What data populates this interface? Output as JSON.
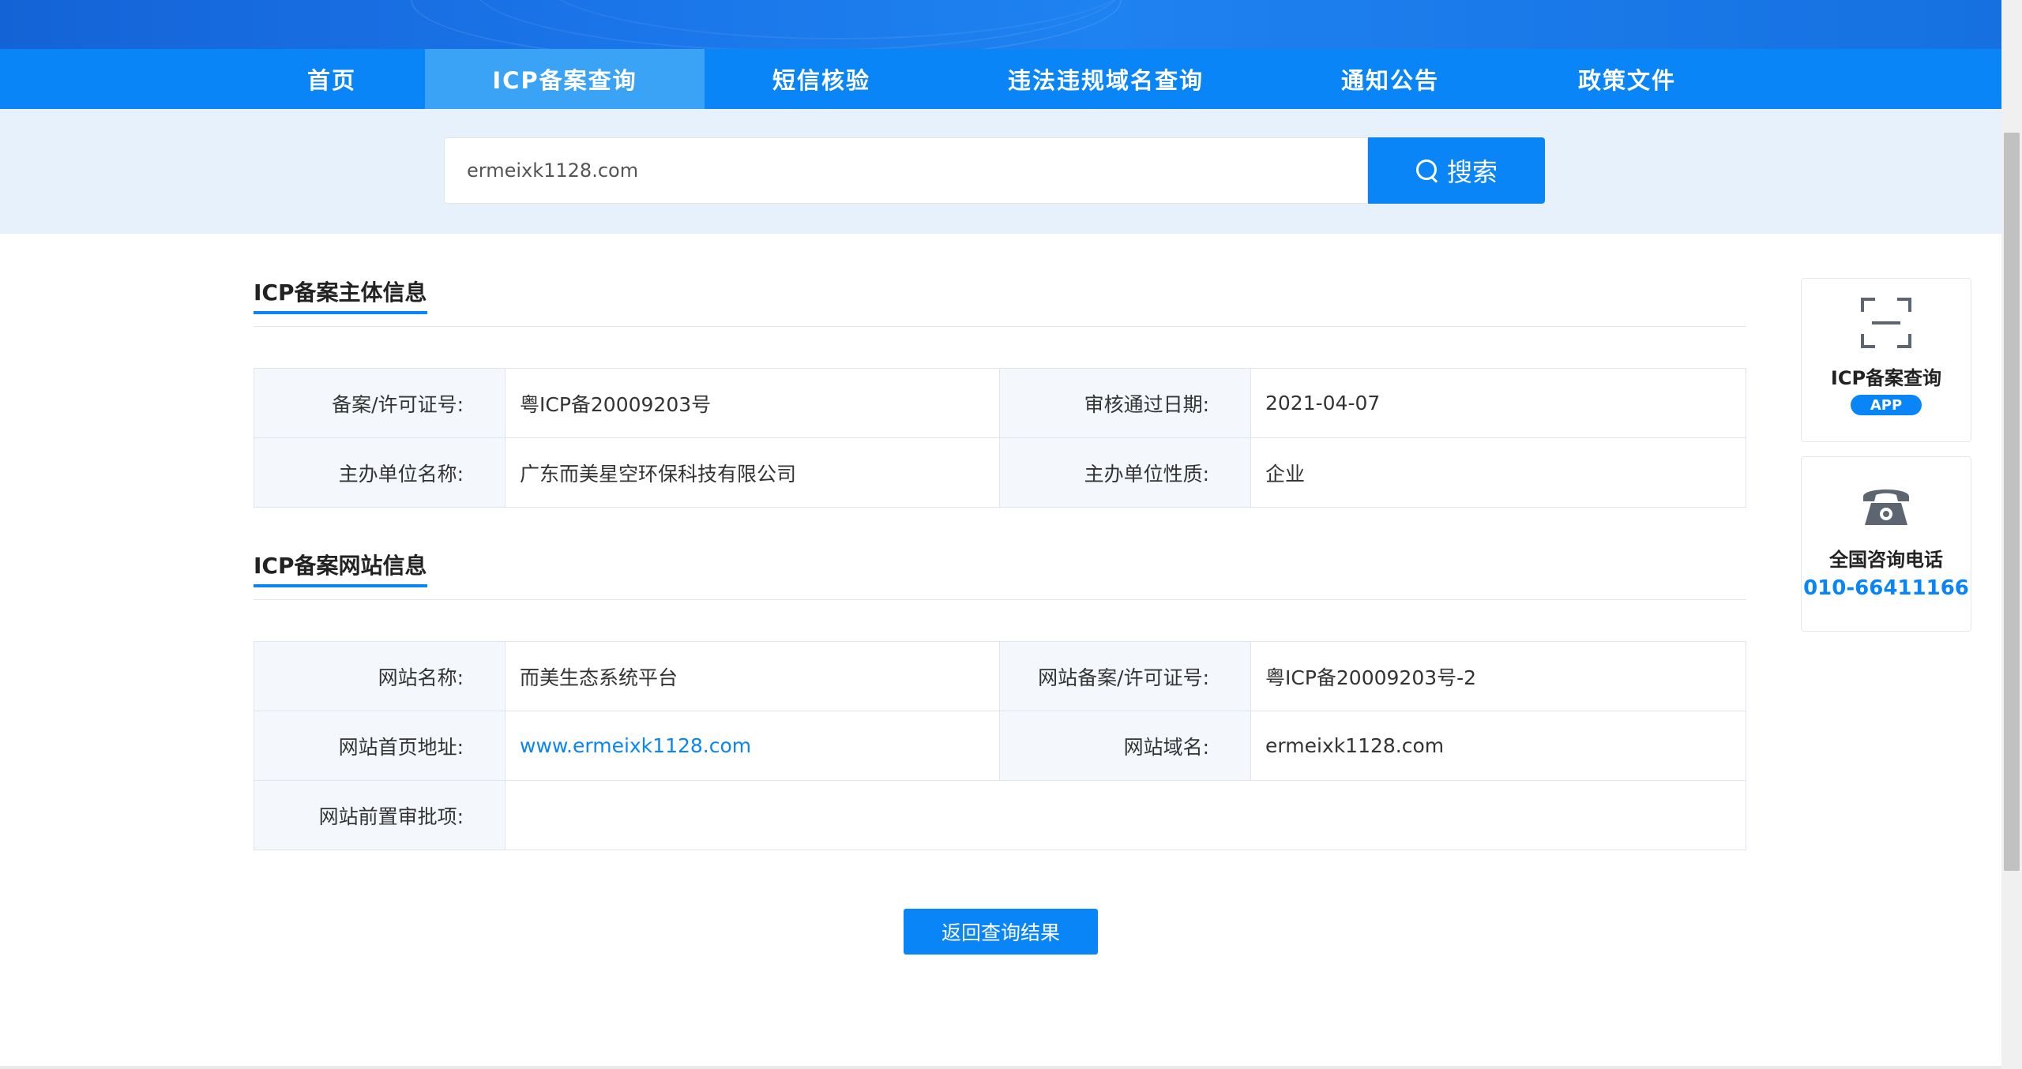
{
  "nav": {
    "items": [
      {
        "label": "首页"
      },
      {
        "label": "ICP备案查询"
      },
      {
        "label": "短信核验"
      },
      {
        "label": "违法违规域名查询"
      },
      {
        "label": "通知公告"
      },
      {
        "label": "政策文件"
      }
    ],
    "active": "ICP备案查询"
  },
  "search": {
    "value": "ermeixk1128.com",
    "button_label": "搜索",
    "icon": "search-icon"
  },
  "subject_section": {
    "title": "ICP备案主体信息",
    "rows": [
      {
        "label1": "备案/许可证号:",
        "value1": "粤ICP备20009203号",
        "label2": "审核通过日期:",
        "value2": "2021-04-07"
      },
      {
        "label1": "主办单位名称:",
        "value1": "广东而美星空环保科技有限公司",
        "label2": "主办单位性质:",
        "value2": "企业"
      }
    ]
  },
  "website_section": {
    "title": "ICP备案网站信息",
    "rows": [
      {
        "label1": "网站名称:",
        "value1": "而美生态系统平台",
        "label2": "网站备案/许可证号:",
        "value2": "粤ICP备20009203号-2"
      },
      {
        "label1": "网站首页地址:",
        "value1": "www.ermeixk1128.com",
        "label2": "网站域名:",
        "value2": "ermeixk1128.com"
      },
      {
        "label1": "网站前置审批项:",
        "value1": ""
      }
    ]
  },
  "return_button_label": "返回查询结果",
  "widgets": {
    "app": {
      "icon": "scan-icon",
      "title": "ICP备案查询",
      "badge": "APP"
    },
    "phone": {
      "icon": "phone-icon",
      "title": "全国咨询电话",
      "number": "010-66411166"
    }
  },
  "colors": {
    "primary": "#0a85f7",
    "nav_active": "#3aa3f5",
    "search_band": "#e6f1fc",
    "label_bg": "#f4f8fc"
  }
}
